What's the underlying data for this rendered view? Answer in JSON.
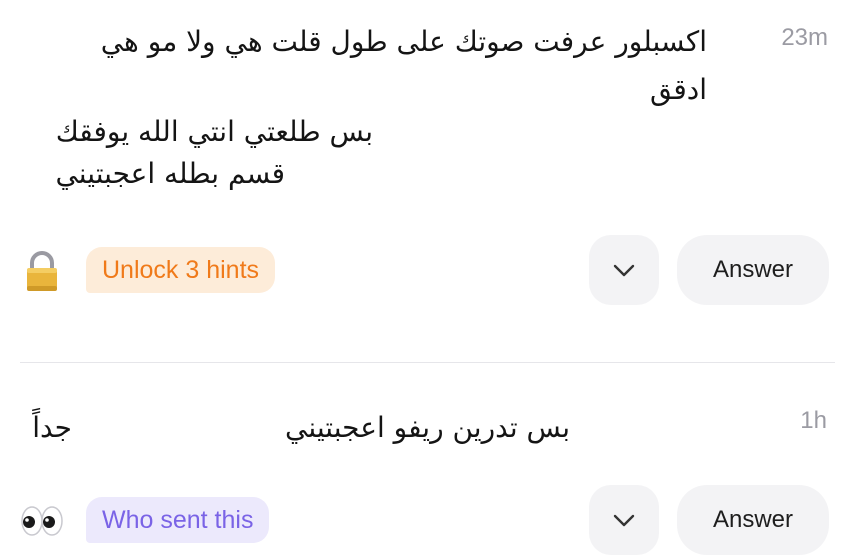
{
  "messages": [
    {
      "timestamp": "23m",
      "text_lines": [
        "اكسبلور عرفت صوتك علی طول قلت هي ولا مو هي",
        "ادقق",
        "بس طلعتي انتي الله يوفقك",
        "قسم بطله اعجبتيني"
      ],
      "hint": {
        "icon": "lock-icon",
        "label": "Unlock 3 hints",
        "color": "#f07a1a"
      },
      "answer_label": "Answer"
    },
    {
      "timestamp": "1h",
      "text_lines": [
        "بس تدرين ريفو اعجبتيني",
        "جداً"
      ],
      "hint": {
        "icon": "eyes-icon",
        "label": "Who sent this",
        "color": "#7a63e6"
      },
      "answer_label": "Answer"
    }
  ]
}
